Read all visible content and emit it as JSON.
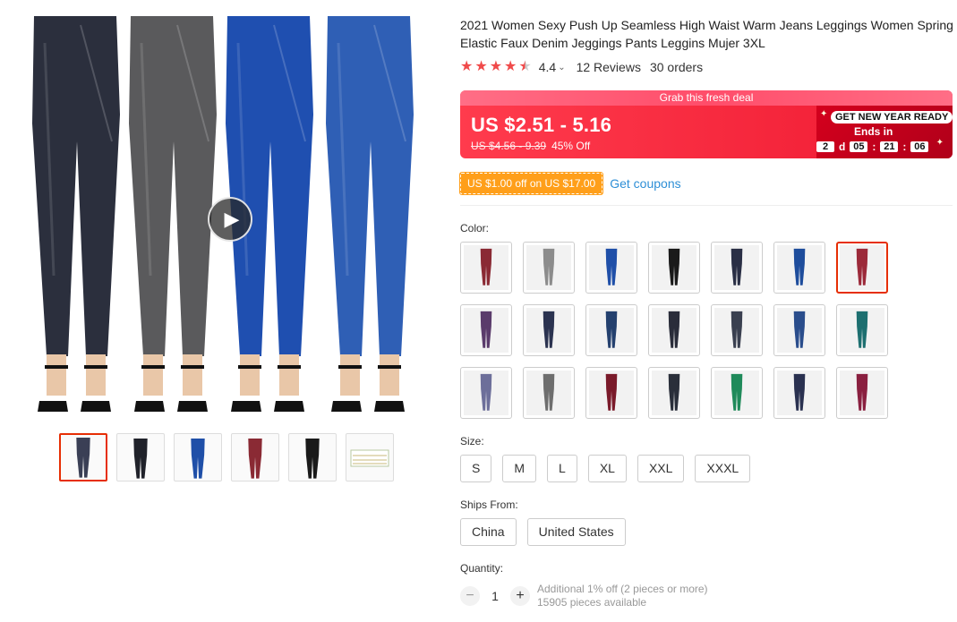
{
  "product": {
    "title": "2021 Women Sexy Push Up Seamless High Waist Warm Jeans Leggings Women Spring Elastic Faux Denim Jeggings Pants Leggins Mujer 3XL",
    "rating": "4.4",
    "reviews": "12 Reviews",
    "orders": "30 orders"
  },
  "deal": {
    "banner": "Grab this fresh deal",
    "price": "US $2.51 - 5.16",
    "old_price": "US $4.56 - 9.39",
    "discount": "45% Off",
    "promo_badge": "GET NEW YEAR READY",
    "ends_in": "Ends in",
    "countdown": {
      "days": "2",
      "day_unit": "d",
      "hours": "05",
      "minutes": "21",
      "seconds": "06"
    }
  },
  "coupon": {
    "tag": "US $1.00 off on US $17.00",
    "link": "Get coupons"
  },
  "labels": {
    "color": "Color:",
    "size": "Size:",
    "ships_from": "Ships From:",
    "quantity": "Quantity:"
  },
  "colors": {
    "selected_index": 6,
    "swatches": [
      "#8a2a34",
      "#8c8c8c",
      "#1f4fa8",
      "#1a1a1a",
      "#2a2f45",
      "#1e4d9c",
      "#9c2a3a",
      "#5a3b6b",
      "#2b3350",
      "#24406e",
      "#2a2d3a",
      "#3a4050",
      "#2a4d8c",
      "#1d6f70",
      "#6d6f9a",
      "#6e6e6e",
      "#7a1a2a",
      "#2a2f3a",
      "#1f8a5a",
      "#2a3150",
      "#8a2040"
    ]
  },
  "sizes": [
    "S",
    "M",
    "L",
    "XL",
    "XXL",
    "XXXL"
  ],
  "ships_from": [
    "China",
    "United States"
  ],
  "quantity": {
    "value": "1",
    "minus": "−",
    "plus": "+",
    "offer": "Additional 1% off (2 pieces or more)",
    "available": "15905 pieces available"
  },
  "gallery": {
    "models": [
      "#2b2f3d",
      "#5a5a5c",
      "#1f4fb0",
      "#2f5fb5"
    ],
    "thumbs": [
      "#3a3f55",
      "#20222a",
      "#1f4fa8",
      "#8a2a34",
      "#1a1a1a",
      "#e8efe0"
    ]
  }
}
